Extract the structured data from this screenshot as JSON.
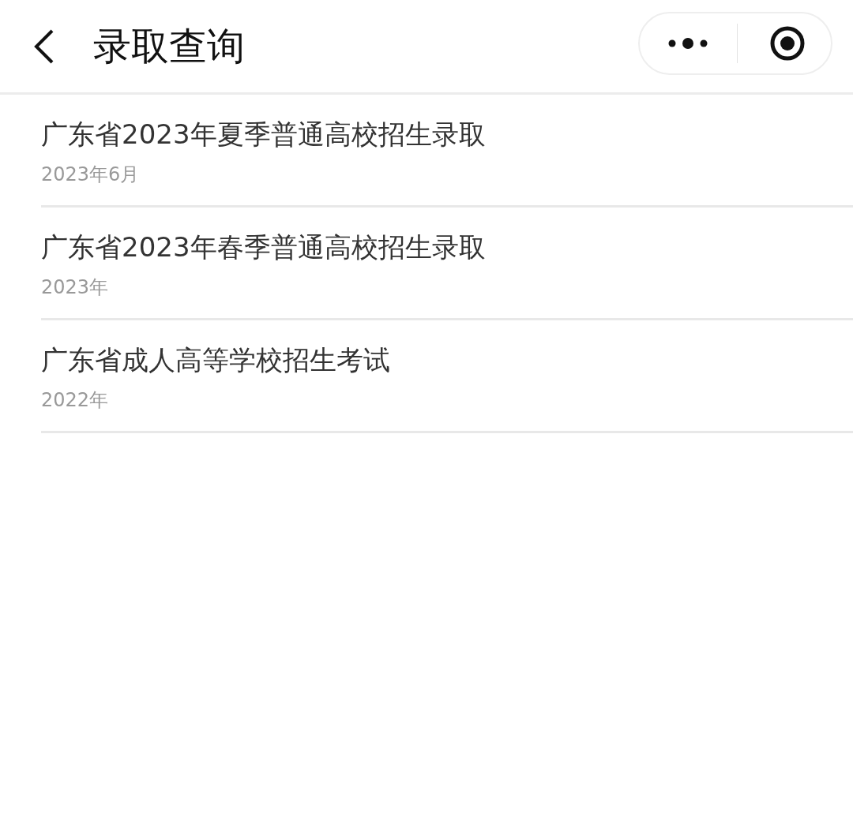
{
  "nav_bar": {
    "title": "录取查询"
  },
  "items": [
    {
      "title": "广东省2023年夏季普通高校招生录取",
      "date": "2023年6月"
    },
    {
      "title": "广东省2023年春季普通高校招生录取",
      "date": "2023年"
    },
    {
      "title": "广东省成人高等学校招生考试",
      "date": "2022年"
    }
  ]
}
